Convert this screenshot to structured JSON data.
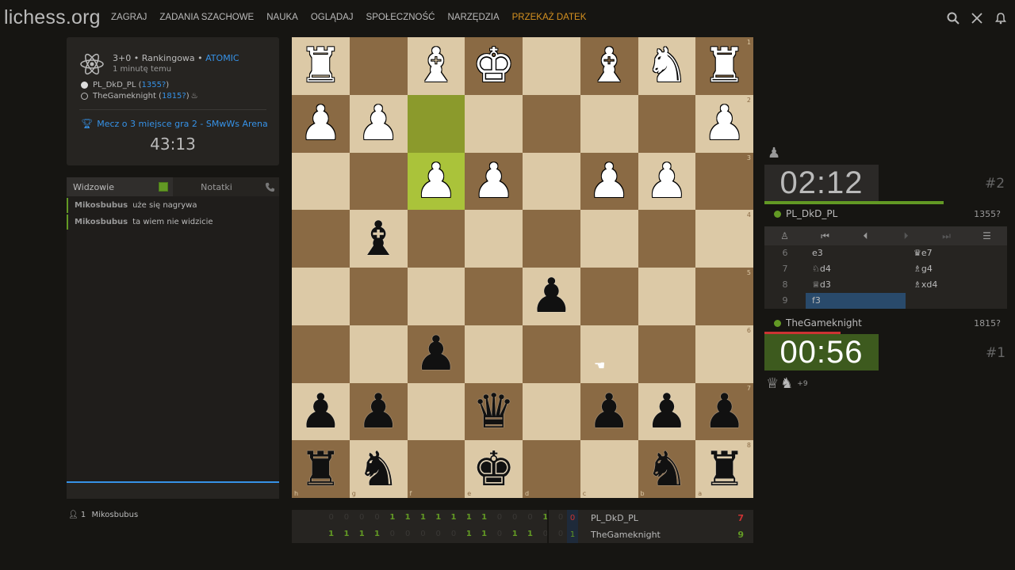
{
  "nav": {
    "logo": "lichess.org",
    "items": [
      "ZAGRAJ",
      "ZADANIA SZACHOWE",
      "NAUKA",
      "OGLĄDAJ",
      "SPOŁECZNOŚĆ",
      "NARZĘDZIA"
    ],
    "donate": "PRZEKAŻ DATEK"
  },
  "game_info": {
    "mode": "3+0 • Rankingowa • ",
    "variant": "ATOMIC",
    "time_ago": "1 minutę temu",
    "white_name": "PL_DkD_PL (",
    "white_rating": "1355?",
    "white_close": ")",
    "black_name": "TheGameknight (",
    "black_rating": "1815?",
    "black_close": ")",
    "arena": "Mecz o 3 miejsce gra 2 - SMwWs Arena",
    "arena_clock": "43:13"
  },
  "chat": {
    "tab_spectators": "Widzowie",
    "tab_notes": "Notatki",
    "messages": [
      {
        "user": "Mikosbubus",
        "text": "uże się nagrywa"
      },
      {
        "user": "Mikosbubus",
        "text": "ta wiem nie widzicie"
      }
    ]
  },
  "spectators": {
    "count": "1",
    "name": "Mikosbubus"
  },
  "board": {
    "ranks": [
      "1",
      "2",
      "3",
      "4",
      "5",
      "6",
      "7",
      "8"
    ],
    "files": [
      "h",
      "g",
      "f",
      "e",
      "d",
      "c",
      "b",
      "a"
    ]
  },
  "clock": {
    "top": "02:12",
    "top_rank": "#2",
    "bottom": "00:56",
    "bottom_rank": "#1"
  },
  "players": {
    "top": {
      "name": "PL_DkD_PL",
      "rating": "1355?"
    },
    "bottom": {
      "name": "TheGameknight",
      "rating": "1815?"
    }
  },
  "moves": [
    {
      "n": "6",
      "w": "e3",
      "b": "♛e7"
    },
    {
      "n": "7",
      "w": "♘d4",
      "b": "♗g4"
    },
    {
      "n": "8",
      "w": "♕d3",
      "b": "♗xd4"
    },
    {
      "n": "9",
      "w": "f3",
      "b": ""
    }
  ],
  "material": {
    "diff": "+9"
  },
  "scoreboard": {
    "top": {
      "name": "PL_DkD_PL",
      "points": "0",
      "total": "7"
    },
    "bottom": {
      "name": "TheGameknight",
      "points": "1",
      "total": "9"
    },
    "top_cells": [
      "0",
      "0",
      "0",
      "0",
      "1",
      "1",
      "1",
      "1",
      "1",
      "1",
      "1",
      "0",
      "0",
      "0",
      "1",
      "0"
    ],
    "bottom_cells": [
      "1",
      "1",
      "1",
      "1",
      "0",
      "0",
      "0",
      "0",
      "0",
      "1",
      "1",
      "0",
      "1",
      "1",
      "0",
      "0"
    ],
    "colors": {
      "win": "#629924",
      "loss_total": "#cc3333"
    }
  }
}
